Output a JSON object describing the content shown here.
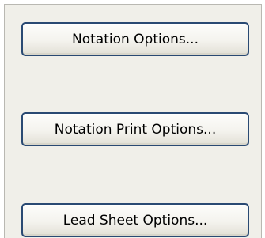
{
  "buttons": {
    "notation_options": "Notation Options...",
    "notation_print_options": "Notation Print Options...",
    "lead_sheet_options": "Lead Sheet Options..."
  },
  "colors": {
    "panel_background": "#f0efe9",
    "button_border": "#2a4a73",
    "page_background": "#ffffff"
  }
}
